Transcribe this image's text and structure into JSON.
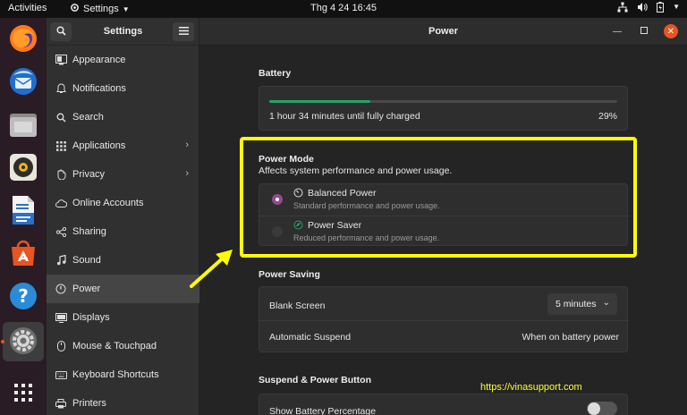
{
  "topbar": {
    "activities": "Activities",
    "app_name": "Settings",
    "clock": "Thg 4 24  16:45",
    "tray_icons": [
      "network-icon",
      "volume-icon",
      "battery-icon"
    ]
  },
  "dock": {
    "items": [
      "firefox-icon",
      "thunderbird-icon",
      "files-icon",
      "rhythmbox-icon",
      "writer-icon",
      "software-icon",
      "help-icon",
      "settings-icon",
      "app-grid-icon"
    ]
  },
  "sidebar": {
    "title": "Settings",
    "items": [
      {
        "label": "Appearance",
        "icon": "appearance-icon"
      },
      {
        "label": "Notifications",
        "icon": "bell-icon"
      },
      {
        "label": "Search",
        "icon": "search-icon"
      },
      {
        "label": "Applications",
        "icon": "apps-grid-icon",
        "chevron": true
      },
      {
        "label": "Privacy",
        "icon": "hand-icon",
        "chevron": true
      },
      {
        "label": "Online Accounts",
        "icon": "cloud-icon"
      },
      {
        "label": "Sharing",
        "icon": "share-icon"
      },
      {
        "label": "Sound",
        "icon": "music-note-icon"
      },
      {
        "label": "Power",
        "icon": "power-icon",
        "selected": true
      },
      {
        "label": "Displays",
        "icon": "display-icon"
      },
      {
        "label": "Mouse & Touchpad",
        "icon": "mouse-icon"
      },
      {
        "label": "Keyboard Shortcuts",
        "icon": "keyboard-icon"
      },
      {
        "label": "Printers",
        "icon": "printer-icon"
      }
    ]
  },
  "main": {
    "title": "Power",
    "battery": {
      "section_title": "Battery",
      "status": "1 hour 34 minutes until fully charged",
      "percent_label": "29%",
      "fraction": 0.29
    },
    "power_mode": {
      "section_title": "Power Mode",
      "subtitle": "Affects system performance and power usage.",
      "options": [
        {
          "label": "Balanced Power",
          "desc": "Standard performance and power usage.",
          "selected": true
        },
        {
          "label": "Power Saver",
          "desc": "Reduced performance and power usage.",
          "selected": false
        }
      ]
    },
    "power_saving": {
      "section_title": "Power Saving",
      "blank_screen_label": "Blank Screen",
      "blank_screen_value": "5 minutes",
      "auto_suspend_label": "Automatic Suspend",
      "auto_suspend_value": "When on battery power"
    },
    "suspend": {
      "section_title": "Suspend & Power Button",
      "show_battery_label": "Show Battery Percentage"
    }
  },
  "annotation": {
    "watermark": "https://vinasupport.com",
    "highlight_color": "#ffff00"
  },
  "colors": {
    "accent": "#924d8b",
    "progress": "#26a269",
    "close": "#e95420"
  }
}
